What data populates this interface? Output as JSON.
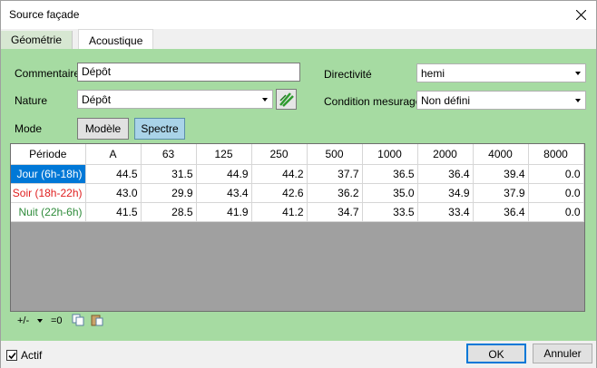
{
  "window": {
    "title": "Source façade",
    "close_icon": "close-icon"
  },
  "tabs": [
    {
      "label": "Géométrie",
      "active": false
    },
    {
      "label": "Acoustique",
      "active": true
    }
  ],
  "form": {
    "commentaire_label": "Commentaire",
    "commentaire_value": "Dépôt",
    "nature_label": "Nature",
    "nature_value": "Dépôt",
    "mode_label": "Mode",
    "mode_modele": "Modèle",
    "mode_spectre": "Spectre",
    "directivite_label": "Directivité",
    "directivite_value": "hemi",
    "condition_label": "Condition mesurage",
    "condition_value": "Non défini"
  },
  "table": {
    "headers": [
      "Période",
      "A",
      "63",
      "125",
      "250",
      "500",
      "1000",
      "2000",
      "4000",
      "8000"
    ],
    "rows": [
      {
        "label": "Jour (6h-18h)",
        "color": "#ffffff",
        "selected": true,
        "values": [
          "44.5",
          "31.5",
          "44.9",
          "44.2",
          "37.7",
          "36.5",
          "36.4",
          "39.4",
          "0.0"
        ]
      },
      {
        "label": "Soir (18h-22h)",
        "color": "#e02020",
        "selected": false,
        "values": [
          "43.0",
          "29.9",
          "43.4",
          "42.6",
          "36.2",
          "35.0",
          "34.9",
          "37.9",
          "0.0"
        ]
      },
      {
        "label": "Nuit (22h-6h)",
        "color": "#2e8b3a",
        "selected": false,
        "values": [
          "41.5",
          "28.5",
          "41.9",
          "41.2",
          "34.7",
          "33.5",
          "33.4",
          "36.4",
          "0.0"
        ]
      }
    ]
  },
  "toolbar": {
    "plusminus": "+/-",
    "equals_zero": "=0"
  },
  "footer": {
    "actif_label": "Actif",
    "actif_checked": true,
    "ok": "OK",
    "cancel": "Annuler"
  },
  "colors": {
    "panel": "#a6dba2",
    "selected_row": "#0078d7",
    "spectre_button": "#a9d3e8"
  }
}
